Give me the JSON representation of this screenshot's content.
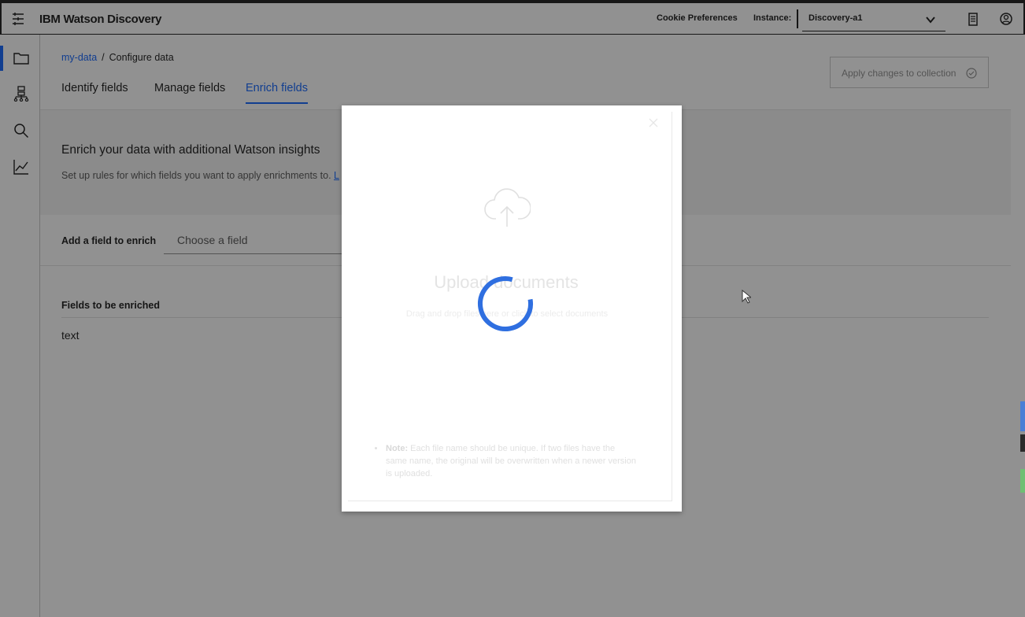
{
  "topbar": {
    "title": "IBM Watson Discovery",
    "cookie_label": "Cookie Preferences",
    "instance_label": "Instance:",
    "instance_value": "Discovery-a1"
  },
  "breadcrumb": {
    "link": "my-data",
    "separator": "/",
    "current": "Configure data"
  },
  "tabs": [
    {
      "label": "Identify fields",
      "active": false
    },
    {
      "label": "Manage fields",
      "active": false
    },
    {
      "label": "Enrich fields",
      "active": true
    }
  ],
  "apply_button": {
    "label": "Apply changes to collection"
  },
  "enrich_panel": {
    "title": "Enrich your data with additional Watson insights",
    "desc": "Set up rules for which fields you want to apply enrichments to.",
    "link": "L"
  },
  "add_field": {
    "label": "Add a field to enrich",
    "placeholder": "Choose a field"
  },
  "fields_table": {
    "header": "Fields to be enriched",
    "rows": [
      "text"
    ]
  },
  "modal": {
    "title": "Upload documents",
    "desc": "Drag and drop files here or click to select documents",
    "note_label": "Note:",
    "note_text": "Each file name should be unique. If two files have the same name, the original will be overwritten when a newer version is uploaded."
  },
  "colors": {
    "accent": "#0f62fe",
    "overlay": "#161616"
  }
}
